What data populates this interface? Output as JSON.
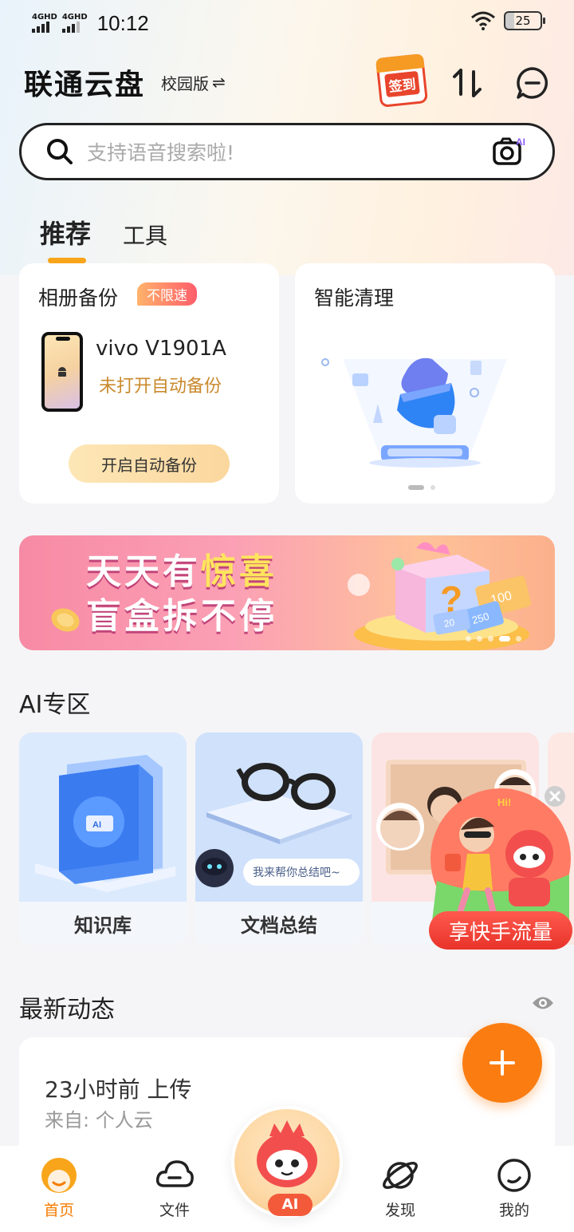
{
  "status_bar": {
    "network_1": "4GHD",
    "network_2": "4GHD",
    "time": "10:12",
    "battery": "25"
  },
  "header": {
    "app_title": "联通云盘",
    "edition": "校园版",
    "edition_switch_icon": "⇌",
    "checkin_label": "签到",
    "icons": [
      "transfer-icon",
      "message-icon"
    ]
  },
  "search": {
    "placeholder": "支持语音搜索啦!",
    "ai_badge": "AI"
  },
  "tabs": [
    {
      "label": "推荐",
      "active": true
    },
    {
      "label": "工具",
      "active": false
    }
  ],
  "backup_card": {
    "title": "相册备份",
    "badge": "不限速",
    "device_name": "vivo V1901A",
    "device_status": "未打开自动备份",
    "button": "开启自动备份"
  },
  "clean_card": {
    "title": "智能清理",
    "page_indicator": {
      "pages": 2,
      "current": 1
    }
  },
  "banner": {
    "line1_prefix": "天天有",
    "line1_highlight": "惊喜",
    "line2": "盲盒拆不停",
    "coupon_1": "100",
    "coupon_2": "250",
    "coupon_3": "20"
  },
  "ai_section": {
    "title": "AI专区",
    "cards": [
      {
        "label": "知识库",
        "art_text": "AI"
      },
      {
        "label": "文档总结",
        "bubble": "我来帮你总结吧~"
      },
      {
        "label": "合"
      }
    ]
  },
  "floating_promo": {
    "label": "享快手流量",
    "hi": "Hi!"
  },
  "feed": {
    "title": "最新动态",
    "time_action": "23小时前  上传",
    "source": "来自: 个人云"
  },
  "bottom_nav": {
    "items": [
      {
        "label": "首页",
        "active": true
      },
      {
        "label": "文件",
        "active": false
      },
      {
        "label": "发现",
        "active": false
      },
      {
        "label": "我的",
        "active": false
      }
    ],
    "center_label": "AI"
  },
  "colors": {
    "accent_orange": "#fb7d12",
    "highlight_gold": "#c98a2d",
    "tab_underline": "#f8a51b",
    "promo_red": "#e8332a"
  }
}
